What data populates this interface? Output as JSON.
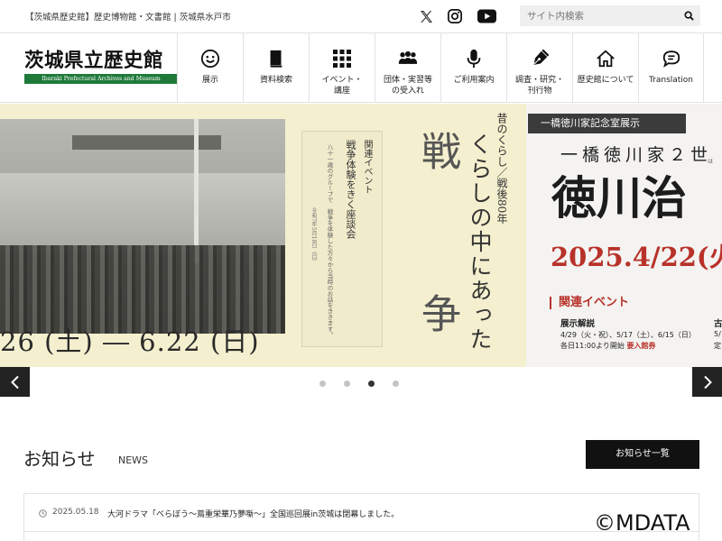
{
  "topbar": {
    "info": "【茨城県歴史館】歴史博物館・文書館 | 茨城県水戸市",
    "search_placeholder": "サイト内検索"
  },
  "logo": {
    "jp": "茨城県立歴史館",
    "en": "Ibaraki Prefectural Archives and Museum"
  },
  "nav": [
    {
      "label": "展示",
      "icon": "smile-icon"
    },
    {
      "label": "資料検索",
      "icon": "book-icon"
    },
    {
      "label": "イベント・\n講座",
      "icon": "grid-icon"
    },
    {
      "label": "団体・実習等\nの受入れ",
      "icon": "people-icon"
    },
    {
      "label": "ご利用案内",
      "icon": "microphone-icon"
    },
    {
      "label": "調査・研究・\n刊行物",
      "icon": "pen-icon"
    },
    {
      "label": "歴史館について",
      "icon": "home-icon"
    },
    {
      "label": "Translation",
      "icon": "speech-bubble-icon"
    }
  ],
  "slide_a": {
    "date_range": "26 (土) ― 6.22 (日)",
    "subtitle": "昔のくらし／戦後80年",
    "title": "くらしの中にあった",
    "big1": "戦",
    "big2": "争",
    "event_title": "関連イベント",
    "event_desc": "戦争体験をきく座談会",
    "event_note": "八十一歳のグループで　戦争を体験した方々から当時のお話をききます。",
    "event_date": "令和7年5月18日（日）"
  },
  "slide_b": {
    "tag": "一橋徳川家記念室展示",
    "line1": "一橋徳川家２世",
    "hint": "は",
    "big": "徳川治",
    "date": "2025.4/22(火",
    "event_title": "関連イベント",
    "sub1": "展示解説",
    "sub1_dates": "4/29（火・祝）、5/17（土）、6/15（日）",
    "sub1_time": "各日11:00より開始",
    "sub1_req": "要入館券",
    "sub2": "古",
    "sub2_dates": "5/",
    "sub2_time": "定"
  },
  "slider": {
    "dot_count": 4,
    "active_index": 2
  },
  "news": {
    "title": "お知らせ",
    "title_en": "NEWS",
    "all_button": "お知らせ一覧",
    "items": [
      {
        "date": "2025.05.18",
        "text": "大河ドラマ「べらぼう～蔦重栄華乃夢噺～」全国巡回展in茨城は閉幕しました。"
      }
    ]
  },
  "watermark": "©MDATA"
}
